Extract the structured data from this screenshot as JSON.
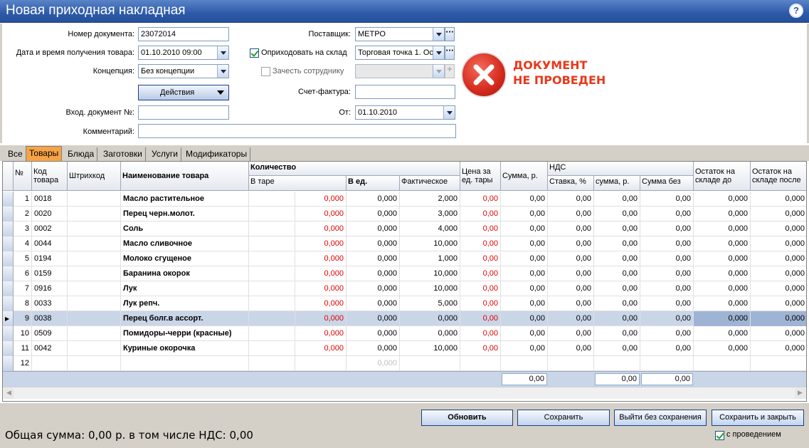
{
  "window": {
    "title": "Новая приходная накладная",
    "help": "?"
  },
  "form": {
    "doc_number_label": "Номер документа:",
    "doc_number": "23072014",
    "date_label": "Дата и время получения товара:",
    "date": "01.10.2010 09:00",
    "concept_label": "Концепция:",
    "concept": "Без концепции",
    "actions_label": "Действия",
    "in_doc_label": "Вход. документ №:",
    "in_doc": "",
    "comment_label": "Комментарий:",
    "comment": "",
    "supplier_label": "Поставщик:",
    "supplier": "МЕТРО",
    "store_check_label": "Оприходовать на склад",
    "store": "Торговая точка 1. Ос",
    "employee_check_label": "Зачесть сотруднику",
    "employee": "",
    "invoice_label": "Счет-фактура:",
    "invoice": "",
    "from_label": "От:",
    "from_date": "01.10.2010"
  },
  "status": {
    "line1": "ДОКУМЕНТ",
    "line2": "НЕ ПРОВЕДЕН",
    "color": "#e8391d"
  },
  "tabs": [
    "Все",
    "Товары",
    "Блюда",
    "Заготовки",
    "Услуги",
    "Модификаторы"
  ],
  "columns": {
    "num": "№",
    "code": "Код товара",
    "barcode": "Штрихкод",
    "name": "Наименование товара",
    "qty": "Количество",
    "in_tare": "В таре",
    "in_units": "В ед.",
    "actual": "Фактическое",
    "price": "Цена за ед. тары",
    "sum": "Сумма, р.",
    "vat": "НДС",
    "vat_rate": "Ставка, %",
    "vat_sum": "сумма, р.",
    "sum_wo": "Сумма без",
    "rest_before": "Остаток на складе до",
    "rest_after": "Остаток на складе после"
  },
  "rows": [
    {
      "n": "1",
      "code": "0018",
      "name": "Масло растительное",
      "tare": "",
      "red": "0,000",
      "units": "0,000",
      "actual": "2,000",
      "price": "0,00",
      "sum": "0,00",
      "rate": "0,00",
      "vsum": "0,00",
      "wo": "0,00",
      "before": "0,000",
      "after": "0,000"
    },
    {
      "n": "2",
      "code": "0020",
      "name": "Перец черн.молот.",
      "tare": "",
      "red": "0,000",
      "units": "0,000",
      "actual": "3,000",
      "price": "0,00",
      "sum": "0,00",
      "rate": "0,00",
      "vsum": "0,00",
      "wo": "0,00",
      "before": "0,000",
      "after": "0,000"
    },
    {
      "n": "3",
      "code": "0002",
      "name": "Соль",
      "tare": "",
      "red": "0,000",
      "units": "0,000",
      "actual": "4,000",
      "price": "0,00",
      "sum": "0,00",
      "rate": "0,00",
      "vsum": "0,00",
      "wo": "0,00",
      "before": "0,000",
      "after": "0,000"
    },
    {
      "n": "4",
      "code": "0044",
      "name": "Масло сливочное",
      "tare": "",
      "red": "0,000",
      "units": "0,000",
      "actual": "10,000",
      "price": "0,00",
      "sum": "0,00",
      "rate": "0,00",
      "vsum": "0,00",
      "wo": "0,00",
      "before": "0,000",
      "after": "0,000"
    },
    {
      "n": "5",
      "code": "0194",
      "name": "Молоко сгущеное",
      "tare": "",
      "red": "0,000",
      "units": "0,000",
      "actual": "1,000",
      "price": "0,00",
      "sum": "0,00",
      "rate": "0,00",
      "vsum": "0,00",
      "wo": "0,00",
      "before": "0,000",
      "after": "0,000"
    },
    {
      "n": "6",
      "code": "0159",
      "name": "Баранина окорок",
      "tare": "",
      "red": "0,000",
      "units": "0,000",
      "actual": "10,000",
      "price": "0,00",
      "sum": "0,00",
      "rate": "0,00",
      "vsum": "0,00",
      "wo": "0,00",
      "before": "0,000",
      "after": "0,000"
    },
    {
      "n": "7",
      "code": "0916",
      "name": "Лук",
      "tare": "",
      "red": "0,000",
      "units": "0,000",
      "actual": "10,000",
      "price": "0,00",
      "sum": "0,00",
      "rate": "0,00",
      "vsum": "0,00",
      "wo": "0,00",
      "before": "0,000",
      "after": "0,000"
    },
    {
      "n": "8",
      "code": "0033",
      "name": "Лук репч.",
      "tare": "",
      "red": "0,000",
      "units": "0,000",
      "actual": "5,000",
      "price": "0,00",
      "sum": "0,00",
      "rate": "0,00",
      "vsum": "0,00",
      "wo": "0,00",
      "before": "0,000",
      "after": "0,000"
    },
    {
      "n": "9",
      "code": "0038",
      "name": "Перец болг.в ассорт.",
      "tare": "",
      "red": "0,000",
      "units": "0,000",
      "actual": "0,000",
      "price": "0,00",
      "sum": "0,00",
      "rate": "0,00",
      "vsum": "0,00",
      "wo": "0,00",
      "before": "0,000",
      "after": "0,000"
    },
    {
      "n": "10",
      "code": "0509",
      "name": "Помидоры-черри (красные)",
      "tare": "",
      "red": "0,000",
      "units": "0,000",
      "actual": "0,000",
      "price": "0,00",
      "sum": "0,00",
      "rate": "0,00",
      "vsum": "0,00",
      "wo": "0,00",
      "before": "0,000",
      "after": "0,000"
    },
    {
      "n": "11",
      "code": "0042",
      "name": "Куриные окорочка",
      "tare": "",
      "red": "0,000",
      "units": "0,000",
      "actual": "10,000",
      "price": "0,00",
      "sum": "0,00",
      "rate": "0,00",
      "vsum": "0,00",
      "wo": "0,00",
      "before": "0,000",
      "after": "0,000"
    },
    {
      "n": "12",
      "code": "",
      "name": "",
      "tare": "",
      "red": "",
      "units": "0,000",
      "actual": "",
      "price": "",
      "sum": "",
      "rate": "",
      "vsum": "",
      "wo": "",
      "before": "",
      "after": ""
    }
  ],
  "totals": {
    "sum": "0,00",
    "vat_sum": "0,00",
    "sum_wo": "0,00"
  },
  "buttons": {
    "refresh": "Обновить",
    "save": "Сохранить",
    "exit": "Выйти без сохранения",
    "save_close": "Сохранить и закрыть"
  },
  "footer": {
    "total": "Общая сумма:  0,00 р. в том числе НДС: 0,00",
    "post_label": "с проведением"
  }
}
